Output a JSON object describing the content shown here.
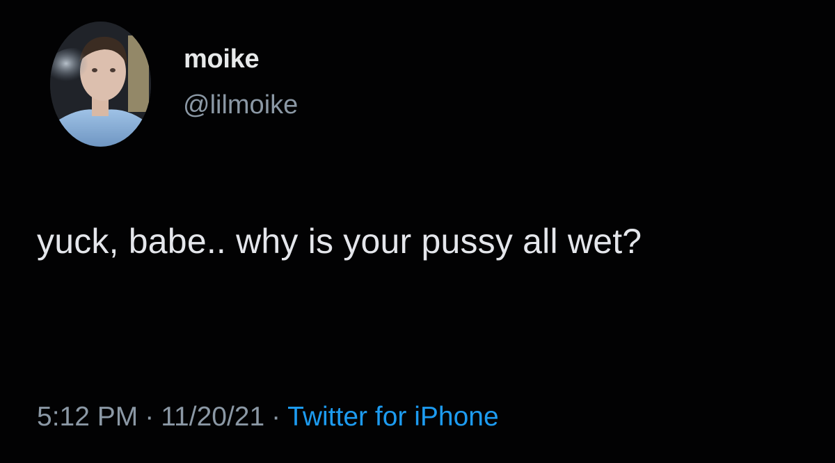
{
  "tweet": {
    "display_name": "moike",
    "handle": "@lilmoike",
    "text": "yuck, babe.. why is your pussy all wet?",
    "time": "5:12 PM",
    "date": "11/20/21",
    "separator": "·",
    "source": "Twitter for iPhone"
  },
  "colors": {
    "background": "#020203",
    "text": "#e7e9ea",
    "secondary_text": "#8b98a5",
    "link": "#1d9bf0"
  },
  "icons": {
    "avatar": "profile-photo"
  }
}
